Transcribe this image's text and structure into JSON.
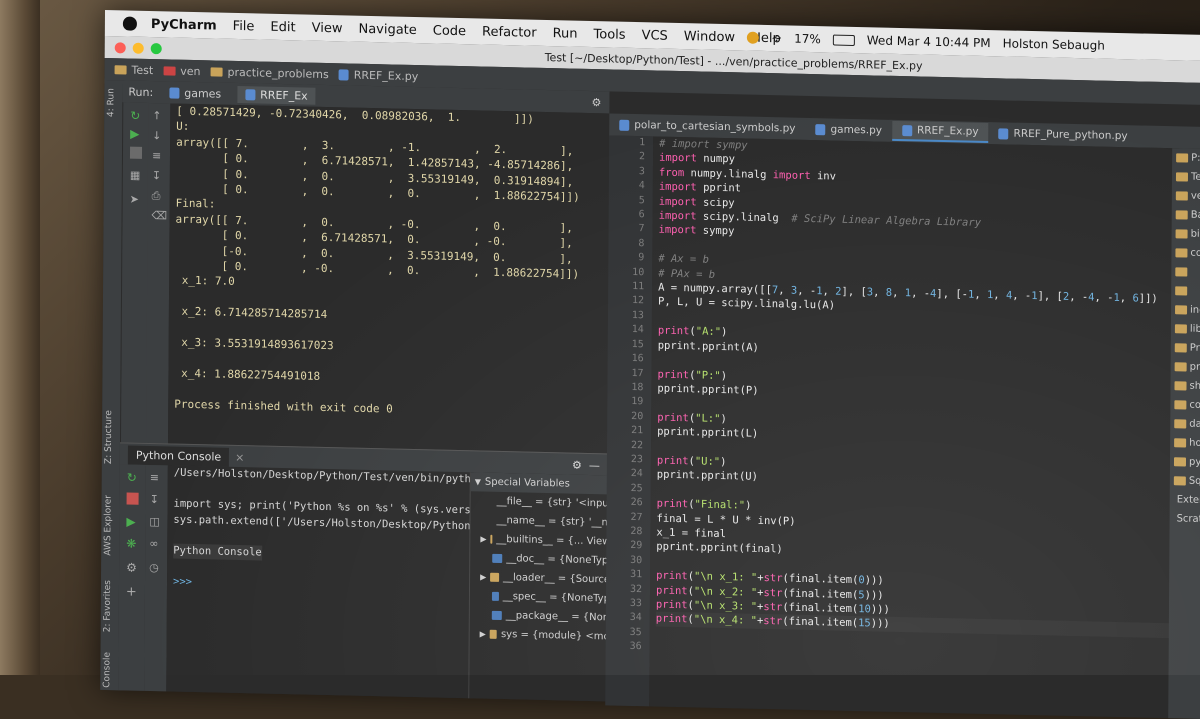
{
  "menubar": {
    "app": "PyCharm",
    "items": [
      "File",
      "Edit",
      "View",
      "Navigate",
      "Code",
      "Refactor",
      "Run",
      "Tools",
      "VCS",
      "Window",
      "Help"
    ],
    "battery": "17%",
    "datetime": "Wed Mar 4  10:44 PM",
    "user": "Holston Sebaugh"
  },
  "window": {
    "title": "Test [~/Desktop/Python/Test] - .../ven/practice_problems/RREF_Ex.py"
  },
  "breadcrumb": [
    "Test",
    "ven",
    "practice_problems",
    "RREF_Ex.py"
  ],
  "run": {
    "label": "Run:",
    "tabs": [
      "games",
      "RREF_Ex"
    ],
    "output": [
      "[ 0.28571429, -0.72340426,  0.08982036,  1.        ]])",
      "U:",
      "array([[ 7.        ,  3.        , -1.        ,  2.        ],",
      "       [ 0.        ,  6.71428571,  1.42857143, -4.85714286],",
      "       [ 0.        ,  0.        ,  3.55319149,  0.31914894],",
      "       [ 0.        ,  0.        ,  0.        ,  1.88622754]])",
      "Final:",
      "array([[ 7.        ,  0.        , -0.        ,  0.        ],",
      "       [ 0.        ,  6.71428571,  0.        , -0.        ],",
      "       [-0.        ,  0.        ,  3.55319149,  0.        ],",
      "       [ 0.        , -0.        ,  0.        ,  1.88622754]])",
      "",
      " x_1: 7.0",
      "",
      " x_2: 6.714285714285714",
      "",
      " x_3: 3.5531914893617023",
      "",
      " x_4: 1.88622754491018",
      "",
      "Process finished with exit code 0"
    ]
  },
  "side_labels": {
    "run": "4: Run",
    "structure": "Z: Structure",
    "aws": "AWS Explorer",
    "favorites": "2: Favorites",
    "console": "Console"
  },
  "console": {
    "tab": "Python Console",
    "lines": [
      "/Users/Holston/Desktop/Python/Test/ven/bin/python",
      "",
      "import sys; print('Python %s on %s' % (sys.versio",
      "sys.path.extend(['/Users/Holston/Desktop/Python/T",
      "",
      "Python Console",
      "",
      ">>>"
    ],
    "variables_header": "Special Variables",
    "variables": [
      "__file__ = {str} '<input",
      "__name__ = {str} '__m",
      "__builtins__ = {... View",
      "__doc__ = {NoneTyp",
      "__loader__ = {Source",
      "__spec__ = {NoneTyp",
      "__package__ = {Non",
      "sys = {module} <mo"
    ]
  },
  "editor": {
    "tabs": [
      "polar_to_cartesian_symbols.py",
      "games.py",
      "RREF_Ex.py",
      "RREF_Pure_python.py"
    ],
    "active_tab": 2,
    "run_config": "RREF_Ex",
    "line_numbers": [
      "1",
      "2",
      "3",
      "4",
      "5",
      "6",
      "7",
      "8",
      "9",
      "10",
      "11",
      "12",
      "13",
      "14",
      "15",
      "16",
      "17",
      "18",
      "19",
      "20",
      "21",
      "22",
      "23",
      "24",
      "25",
      "26",
      "27",
      "28",
      "29",
      "30",
      "31",
      "32",
      "33",
      "34",
      "35",
      "36"
    ]
  },
  "project": {
    "items": [
      "P:",
      "Test",
      "ven",
      "Ba",
      "bin",
      "coo",
      "",
      "",
      "incl",
      "lib",
      "Prac",
      "prac",
      "shar",
      "com",
      "dayl",
      "home",
      "pyve",
      "Squa",
      "External Lib",
      "Scratches a"
    ]
  }
}
